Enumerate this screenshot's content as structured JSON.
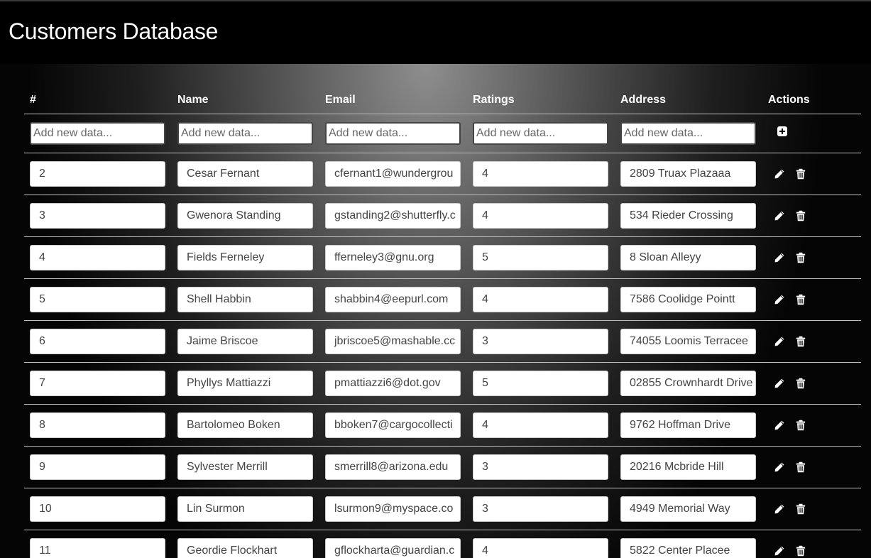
{
  "app": {
    "title": "Customers Database"
  },
  "table": {
    "headers": {
      "id": "#",
      "name": "Name",
      "email": "Email",
      "ratings": "Ratings",
      "address": "Address",
      "actions": "Actions"
    },
    "new_row_placeholder": "Add new data...",
    "rows": [
      {
        "id": "2",
        "name": "Cesar Fernant",
        "email": "cfernant1@wundergrou",
        "rating": "4",
        "address": "2809 Truax Plazaaa"
      },
      {
        "id": "3",
        "name": "Gwenora Standing",
        "email": "gstanding2@shutterfly.c",
        "rating": "4",
        "address": "534 Rieder Crossing"
      },
      {
        "id": "4",
        "name": "Fields Ferneley",
        "email": "fferneley3@gnu.org",
        "rating": "5",
        "address": "8 Sloan Alleyy"
      },
      {
        "id": "5",
        "name": "Shell Habbin",
        "email": "shabbin4@eepurl.com",
        "rating": "4",
        "address": "7586 Coolidge Pointt"
      },
      {
        "id": "6",
        "name": "Jaime Briscoe",
        "email": "jbriscoe5@mashable.cc",
        "rating": "3",
        "address": "74055 Loomis Terracee"
      },
      {
        "id": "7",
        "name": "Phyllys Mattiazzi",
        "email": "pmattiazzi6@dot.gov",
        "rating": "5",
        "address": "02855 Crownhardt Drive"
      },
      {
        "id": "8",
        "name": "Bartolomeo Boken",
        "email": "bboken7@cargocollecti",
        "rating": "4",
        "address": "9762 Hoffman Drive"
      },
      {
        "id": "9",
        "name": "Sylvester Merrill",
        "email": "smerrill8@arizona.edu",
        "rating": "3",
        "address": "20216 Mcbride Hill"
      },
      {
        "id": "10",
        "name": "Lin Surmon",
        "email": "lsurmon9@myspace.co",
        "rating": "3",
        "address": "4949 Memorial Way"
      },
      {
        "id": "11",
        "name": "Geordie Flockhart",
        "email": "gflockharta@guardian.c",
        "rating": "4",
        "address": "5822 Center Placee"
      }
    ]
  },
  "icons": {
    "add": "plus-square-icon",
    "edit": "pencil-icon",
    "delete": "trash-icon"
  },
  "colors": {
    "header_bg": "#000000",
    "title_text": "#ffffff"
  }
}
